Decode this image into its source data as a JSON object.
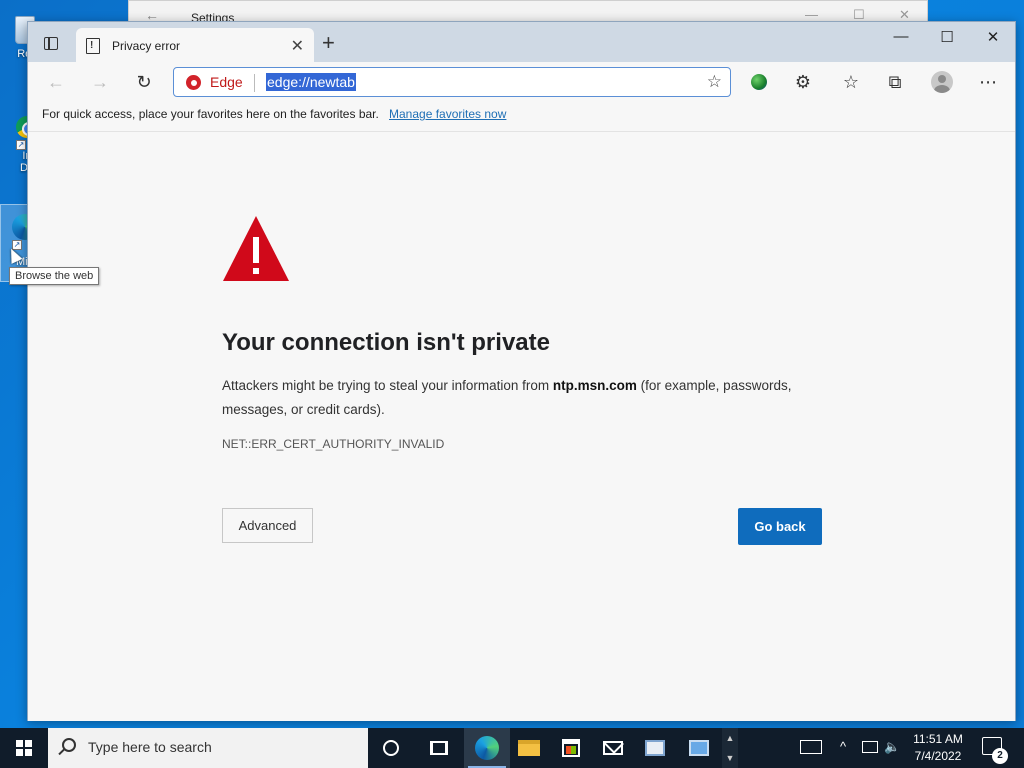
{
  "desktop": {
    "recycle_label": "Rec",
    "chrome_label_1": "In",
    "chrome_label_2": "Do",
    "edge_label": "Mi"
  },
  "tooltip": "Browse the web",
  "settings_window": {
    "title": "Settings",
    "back": "←",
    "min": "—",
    "max": "☐",
    "close": "✕"
  },
  "browser": {
    "tab": {
      "label": "Privacy error",
      "close": "✕"
    },
    "new_tab": "+",
    "window_controls": {
      "minimize": "—",
      "maximize": "☐",
      "close": "✕"
    },
    "nav": {
      "back": "←",
      "forward": "→",
      "refresh": "↻"
    },
    "address": {
      "site_name": "Edge",
      "url": "edge://newtab",
      "add_favorite": "☆"
    },
    "toolbar_icons": {
      "extensions": "⚙",
      "favorites": "☆",
      "collections": "⧉",
      "more": "⋯"
    },
    "favorites_bar": {
      "message": "For quick access, place your favorites here on the favorites bar.",
      "link": "Manage favorites now"
    }
  },
  "error": {
    "title": "Your connection isn't private",
    "desc_prefix": "Attackers might be trying to steal your information from ",
    "desc_host": "ntp.msn.com",
    "desc_suffix": " (for example, passwords, messages, or credit cards).",
    "code": "NET::ERR_CERT_AUTHORITY_INVALID",
    "advanced_label": "Advanced",
    "goback_label": "Go back",
    "accent": "#0f6cbd",
    "warning_color": "#d0091a"
  },
  "taskbar": {
    "search_placeholder": "Type here to search",
    "time": "11:51 AM",
    "date": "7/4/2022",
    "notification_count": "2",
    "tray_up": "^",
    "tray_volume": "🔈",
    "scroll_up": "▲",
    "scroll_down": "▼"
  }
}
